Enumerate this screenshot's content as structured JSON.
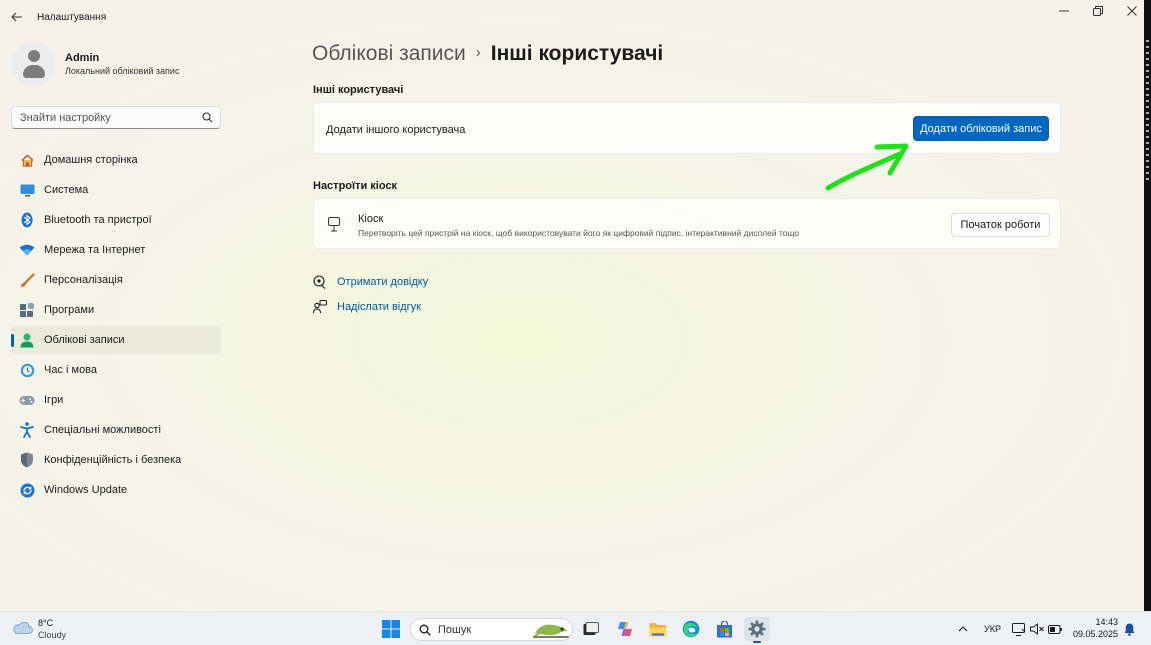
{
  "window": {
    "title": "Налаштування"
  },
  "profile": {
    "name": "Admin",
    "account_type": "Локальний обліковий запис"
  },
  "search": {
    "placeholder": "Знайти настройку"
  },
  "nav": {
    "items": [
      {
        "label": "Домашня сторінка",
        "icon": "home-icon"
      },
      {
        "label": "Система",
        "icon": "system-icon"
      },
      {
        "label": "Bluetooth та пристрої",
        "icon": "bluetooth-icon"
      },
      {
        "label": "Мережа та Інтернет",
        "icon": "wifi-icon"
      },
      {
        "label": "Персоналізація",
        "icon": "brush-icon"
      },
      {
        "label": "Програми",
        "icon": "apps-icon"
      },
      {
        "label": "Облікові записи",
        "icon": "accounts-icon",
        "active": true
      },
      {
        "label": "Час і мова",
        "icon": "time-language-icon"
      },
      {
        "label": "Ігри",
        "icon": "gamepad-icon"
      },
      {
        "label": "Спеціальні можливості",
        "icon": "accessibility-icon"
      },
      {
        "label": "Конфіденційність і безпека",
        "icon": "shield-icon"
      },
      {
        "label": "Windows Update",
        "icon": "windows-update-icon"
      }
    ]
  },
  "breadcrumb": {
    "parent": "Облікові записи",
    "separator": "›",
    "current": "Інші користувачі"
  },
  "other_users": {
    "section_title": "Інші користувачі",
    "add_label": "Додати іншого користувача",
    "add_button": "Додати обліковий запис"
  },
  "kiosk": {
    "section_title": "Настроїти кіоск",
    "title": "Кіоск",
    "description": "Перетворіть цей пристрій на кіоск, щоб використовувати його як цифровий підпис, інтерактивний дисплей тощо",
    "button": "Початок роботи"
  },
  "links": {
    "help": "Отримати довідку",
    "feedback": "Надіслати відгук"
  },
  "taskbar": {
    "weather_temp": "8°C",
    "weather_condition": "Cloudy",
    "search_placeholder": "Пошук",
    "language": "УКР",
    "time": "14:43",
    "date": "09.05.2025"
  },
  "colors": {
    "accent": "#0067c0",
    "annotation_arrow": "#22e01a"
  }
}
